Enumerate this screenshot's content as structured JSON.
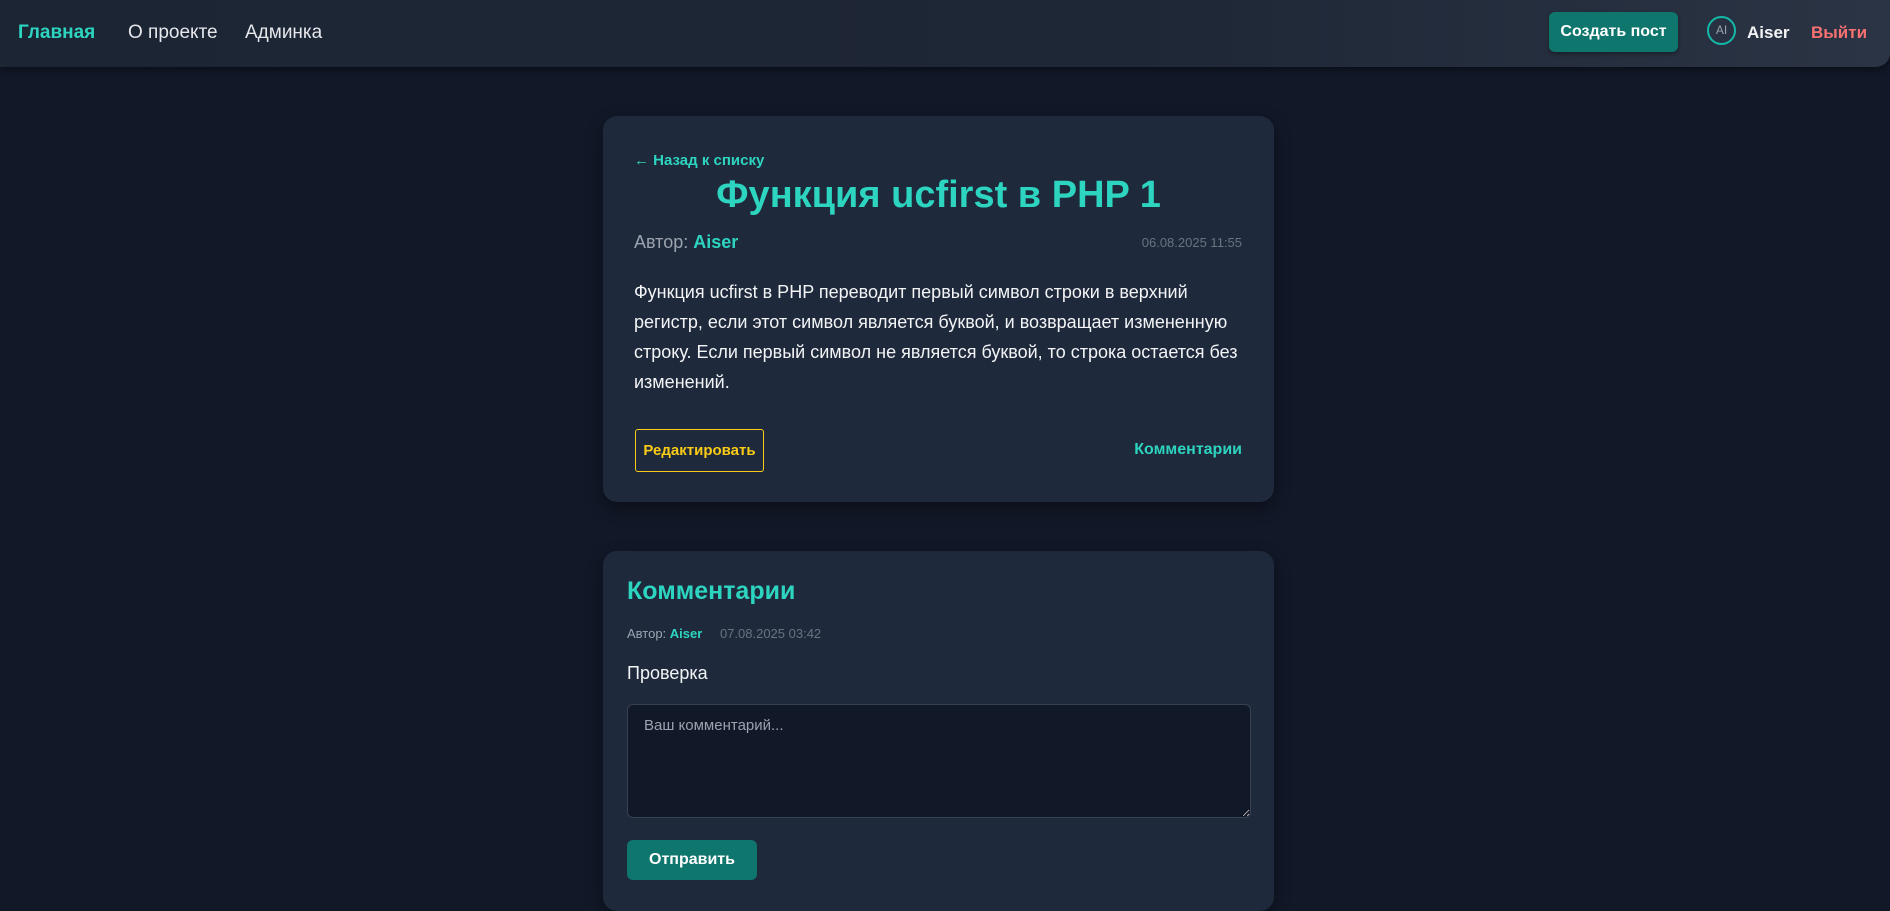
{
  "nav": {
    "home": "Главная",
    "about": "О проекте",
    "admin": "Админка",
    "create_post": "Создать пост",
    "avatar_initials": "AI",
    "user_name": "Aiser",
    "logout": "Выйти"
  },
  "post": {
    "back_link": "← Назад к списку",
    "title": "Функция ucfirst в PHP 1",
    "author_label": "Автор:",
    "author": "Aiser",
    "date": "06.08.2025 11:55",
    "body": "Функция ucfirst в PHP переводит первый символ строки в верхний регистр, если этот символ является буквой, и возвращает измененную строку. Если первый символ не является буквой, то строка остается без изменений.",
    "edit_label": "Редактировать",
    "comments_link": "Комментарии"
  },
  "comments": {
    "title": "Комментарии",
    "items": [
      {
        "author_label": "Автор:",
        "author": "Aiser",
        "date": "07.08.2025 03:42",
        "text": "Проверка"
      }
    ],
    "input_placeholder": "Ваш комментарий...",
    "submit_label": "Отправить"
  },
  "colors": {
    "accent": "#2dd4bf",
    "button": "#0f766e",
    "danger": "#f87171",
    "warning": "#facc15",
    "background": "#111827",
    "card": "#1e293b"
  }
}
